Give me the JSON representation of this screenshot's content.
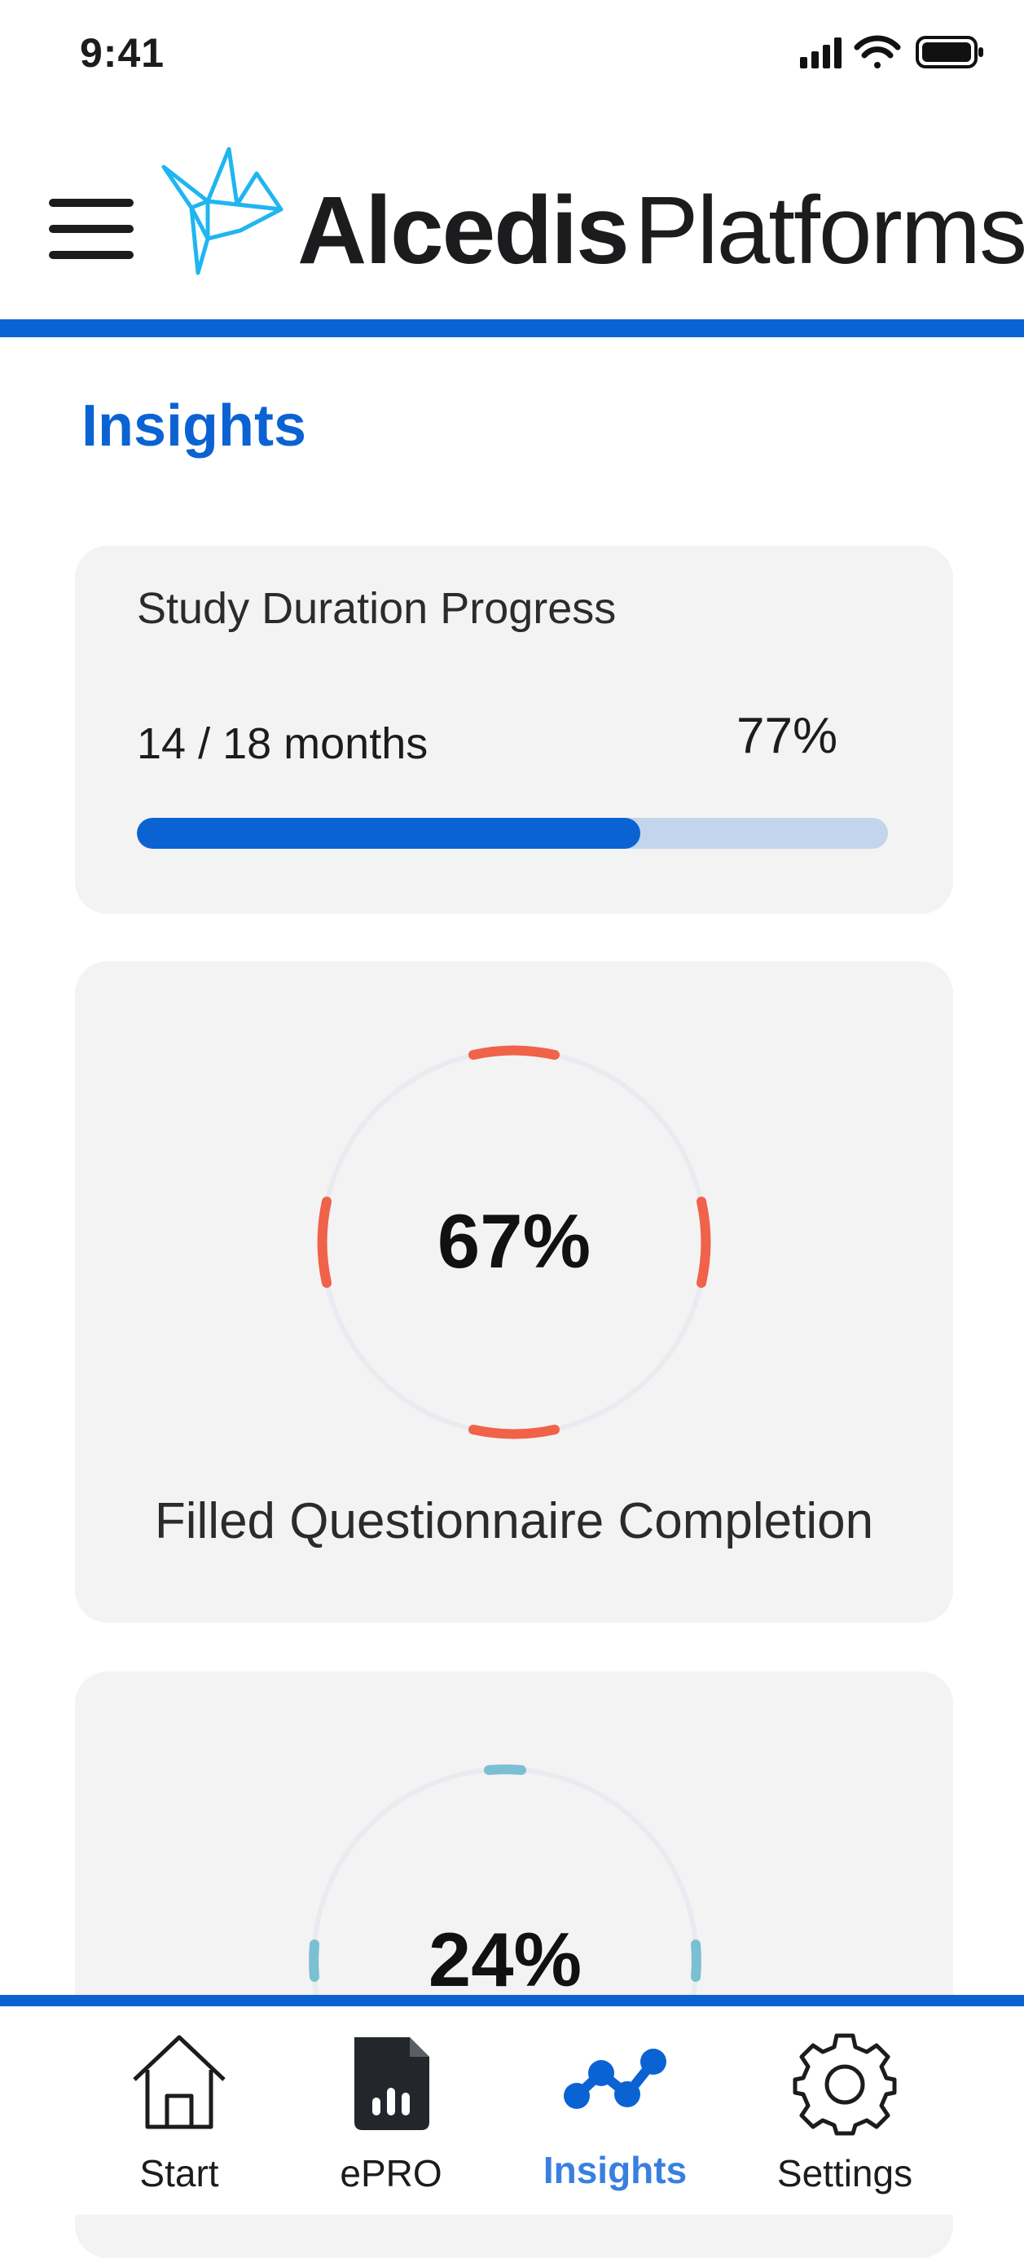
{
  "status_bar": {
    "time": "9:41",
    "icons": [
      "signal-icon",
      "wifi-icon",
      "battery-icon"
    ]
  },
  "header": {
    "menu_icon": "hamburger-menu-icon",
    "logo_bold": "Alcedis",
    "logo_light": "Platforms",
    "logo_icon": "origami-bird-icon"
  },
  "page": {
    "title": "Insights"
  },
  "cards": {
    "study_duration": {
      "title": "Study Duration Progress",
      "months_text": "14 / 18 months",
      "percent_text": "77%",
      "progress_fraction": 0.67
    },
    "questionnaire": {
      "percent_text": "67%",
      "label": "Filled Questionnaire Completion",
      "accent_color": "#f0624a"
    },
    "third": {
      "percent_text": "24%",
      "accent_color": "#7bbfd2"
    }
  },
  "bottom_nav": {
    "items": [
      {
        "label": "Start",
        "icon": "home-icon"
      },
      {
        "label": "ePRO",
        "icon": "document-chart-icon"
      },
      {
        "label": "Insights",
        "icon": "insights-graph-icon",
        "active": true
      },
      {
        "label": "Settings",
        "icon": "gear-icon"
      }
    ]
  },
  "colors": {
    "brand_blue": "#0b63d3",
    "card_bg": "#f3f3f3",
    "progress_track": "#c2d5ec",
    "logo_bird": "#1fb6f0"
  }
}
